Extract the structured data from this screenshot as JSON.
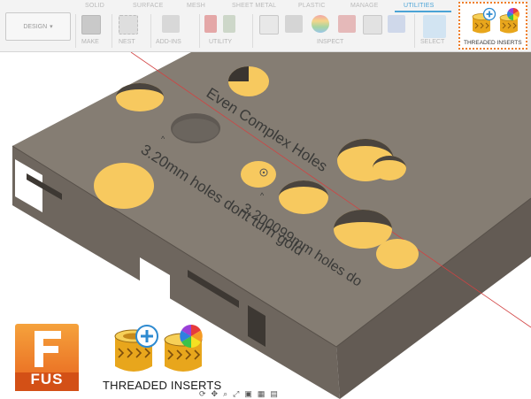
{
  "toolbar": {
    "tabs": [
      "SOLID",
      "SURFACE",
      "MESH",
      "SHEET METAL",
      "PLASTIC",
      "MANAGE",
      "UTILITIES"
    ],
    "active_tab": "UTILITIES",
    "workspace": "DESIGN",
    "groups": [
      "MAKE",
      "NEST",
      "ADD-INS",
      "UTILITY",
      "INSPECT",
      "SELECT"
    ],
    "threaded_inserts_label": "THREADED INSERTS",
    "accent_color": "#4ba3d6",
    "highlight_color": "#f07f2a"
  },
  "model": {
    "title_text": "Even Complex Holes",
    "left_text": "3.20mm holes dont turn gold",
    "right_text": "3.200099mm holes do",
    "gold_color": "#f7c95f",
    "body_color": "#857d73"
  },
  "overlay": {
    "logo_text": "FUS",
    "logo_letter": "F",
    "caption": "THREADED INSERTS",
    "logo_color": "#e8641e"
  },
  "icons": [
    "design-dropdown-icon",
    "threaded-insert-add-icon",
    "threaded-insert-color-icon",
    "orbit-icon",
    "pan-icon",
    "zoom-icon",
    "display-icon",
    "grid-icon"
  ]
}
